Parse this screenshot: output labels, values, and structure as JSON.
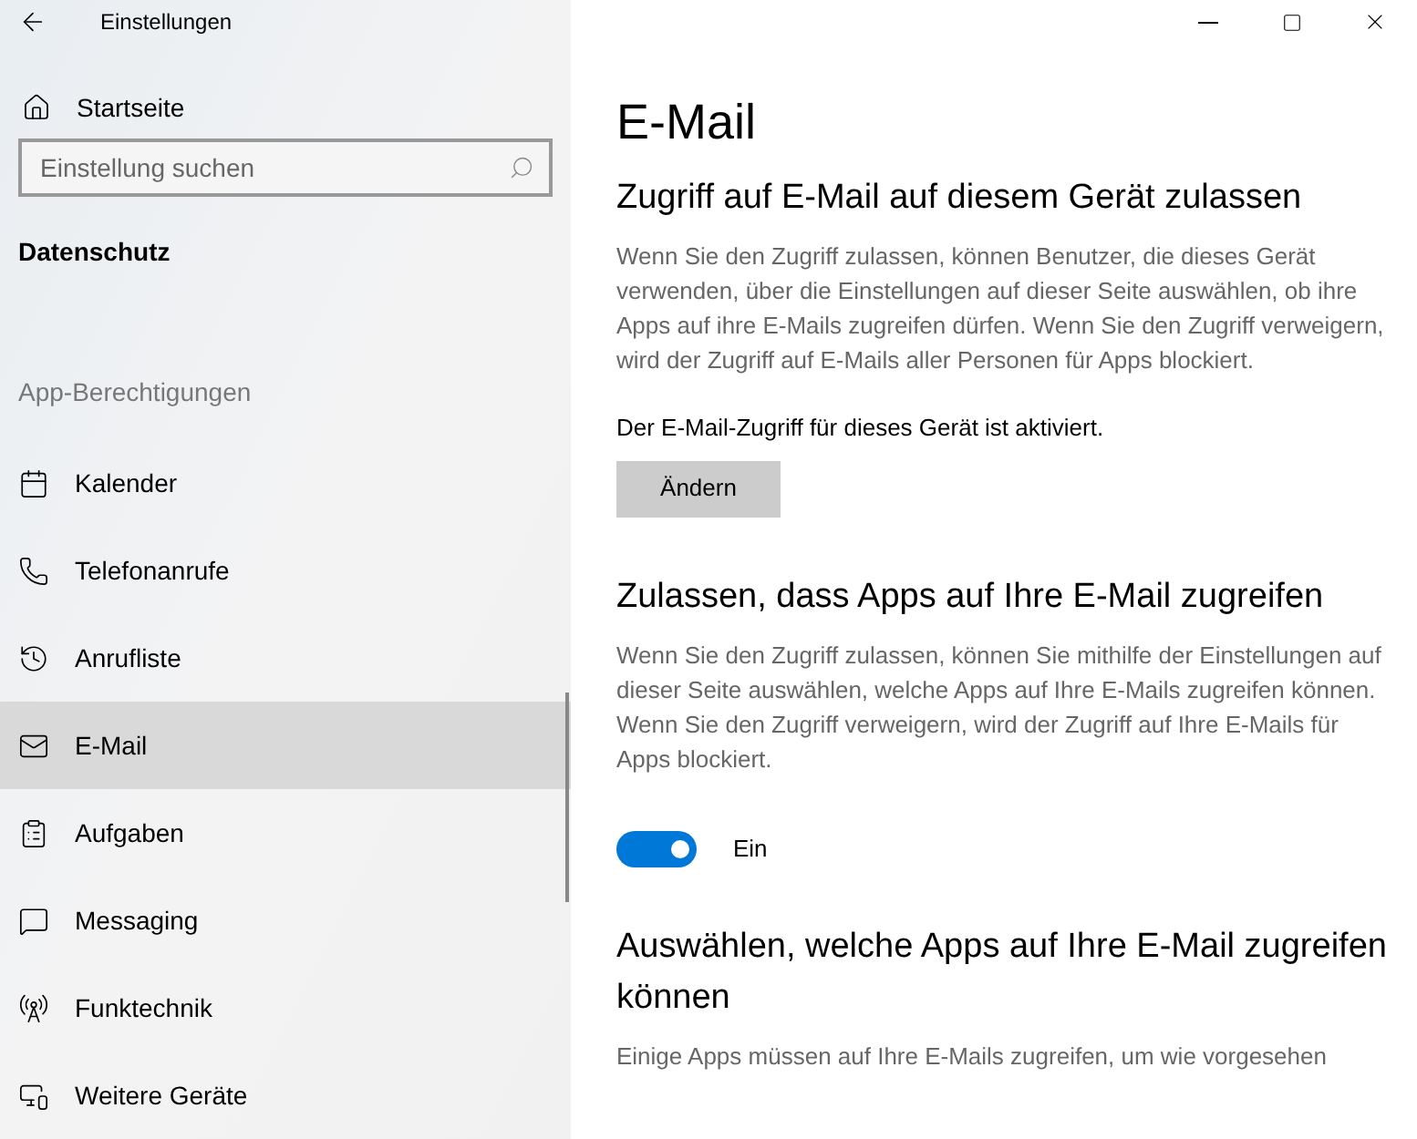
{
  "window": {
    "title": "Einstellungen"
  },
  "sidebar": {
    "home": "Startseite",
    "search": {
      "placeholder": "Einstellung suchen"
    },
    "category": "Datenschutz",
    "section": "App-Berechtigungen",
    "items": [
      {
        "label": "Kalender",
        "kind": "calendar",
        "selected": false
      },
      {
        "label": "Telefonanrufe",
        "kind": "phone",
        "selected": false
      },
      {
        "label": "Anrufliste",
        "kind": "history",
        "selected": false
      },
      {
        "label": "E-Mail",
        "kind": "mail",
        "selected": true
      },
      {
        "label": "Aufgaben",
        "kind": "tasks",
        "selected": false
      },
      {
        "label": "Messaging",
        "kind": "message",
        "selected": false
      },
      {
        "label": "Funktechnik",
        "kind": "radio",
        "selected": false
      },
      {
        "label": "Weitere Geräte",
        "kind": "devices",
        "selected": false
      }
    ]
  },
  "page": {
    "title": "E-Mail",
    "sections": [
      {
        "heading": "Zugriff auf E-Mail auf diesem Gerät zulassen",
        "text": "Wenn Sie den Zugriff zulassen, können Benutzer, die dieses Gerät verwenden, über die Einstellungen auf dieser Seite auswählen, ob ihre Apps auf ihre E-Mails zugreifen dürfen. Wenn Sie den Zugriff verweigern, wird der Zugriff auf E-Mails aller Personen für Apps blockiert.",
        "status": "Der E-Mail-Zugriff für dieses Gerät ist aktiviert.",
        "button": "Ändern"
      },
      {
        "heading": "Zulassen, dass Apps auf Ihre E-Mail zugreifen",
        "text": "Wenn Sie den Zugriff zulassen, können Sie mithilfe der Einstellungen auf dieser Seite auswählen, welche Apps auf Ihre E-Mails zugreifen können. Wenn Sie den Zugriff verweigern, wird der Zugriff auf Ihre E-Mails für Apps blockiert.",
        "toggle": {
          "on": true,
          "label": "Ein"
        }
      },
      {
        "heading": "Auswählen, welche Apps auf Ihre E-Mail zugreifen können",
        "text": "Einige Apps müssen auf Ihre E-Mails zugreifen, um wie vorgesehen"
      }
    ]
  }
}
